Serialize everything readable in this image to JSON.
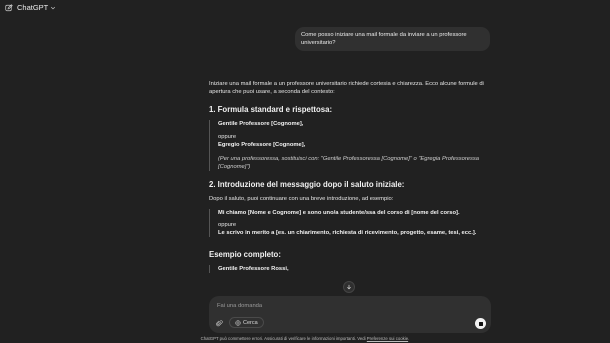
{
  "header": {
    "title": "ChatGPT"
  },
  "user_message": "Come posso iniziare una mail formale da inviare a un professore universitario?",
  "answer": {
    "intro": "Iniziare una mail formale a un professore universitario richiede cortesia e chiarezza. Ecco alcune formule di apertura che puoi usare, a seconda del contesto:",
    "section1": {
      "heading": "1. Formula standard e rispettosa:",
      "line1": "Gentile Professore [Cognome],",
      "oppure": "oppure",
      "line2": "Egregio Professore [Cognome],",
      "note": "(Per una professoressa, sostituisci con: \"Gentile Professoressa [Cognome]\" o \"Egregia Professoressa [Cognome]\")"
    },
    "section2": {
      "heading": "2. Introduzione del messaggio dopo il saluto iniziale:",
      "intro": "Dopo il saluto, puoi continuare con una breve introduzione, ad esempio:",
      "line1": "Mi chiamo [Nome e Cognome] e sono uno/a studente/ssa del corso di [nome del corso].",
      "oppure": "oppure",
      "line2": "Le scrivo in merito a [es. un chiarimento, richiesta di ricevimento, progetto, esame, tesi, ecc.]."
    },
    "section3": {
      "heading": "Esempio completo:",
      "line1": "Gentile Professore Rossi,"
    }
  },
  "composer": {
    "placeholder": "Fai una domanda",
    "search_label": "Cerca"
  },
  "disclaimer": {
    "text": "ChatGPT può commettere errori. Assicurati di verificare le informazioni importanti. Vedi ",
    "link": "Preferenze sui cookie",
    "end": "."
  }
}
